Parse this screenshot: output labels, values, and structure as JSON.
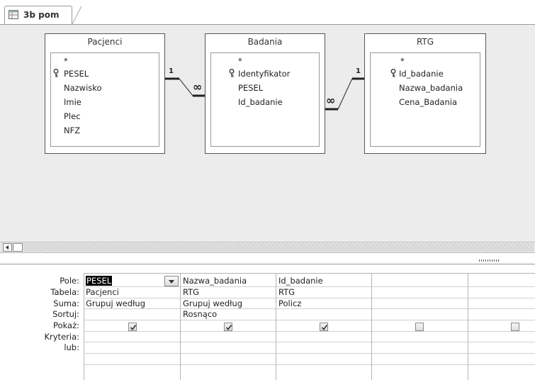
{
  "tab": {
    "label": "3b pom",
    "icon": "query-icon"
  },
  "tables": [
    {
      "title": "Pacjenci",
      "fields": [
        "*",
        "PESEL",
        "Nazwisko",
        "Imie",
        "Plec",
        "NFZ"
      ],
      "key_field": "PESEL"
    },
    {
      "title": "Badania",
      "fields": [
        "*",
        "Identyfikator",
        "PESEL",
        "Id_badanie"
      ],
      "key_field": "Identyfikator"
    },
    {
      "title": "RTG",
      "fields": [
        "*",
        "Id_badanie",
        "Nazwa_badania",
        "Cena_Badania"
      ],
      "key_field": "Id_badanie"
    }
  ],
  "relations": [
    {
      "one": "1",
      "many": "∞"
    },
    {
      "one": "1",
      "many": "∞"
    }
  ],
  "grid": {
    "row_labels": [
      "Pole:",
      "Tabela:",
      "Suma:",
      "Sortuj:",
      "Pokaż:",
      "Kryteria:",
      "lub:"
    ],
    "columns": [
      {
        "pole": "PESEL",
        "tabela": "Pacjenci",
        "suma": "Grupuj według",
        "sortuj": "",
        "pokaz": true
      },
      {
        "pole": "Nazwa_badania",
        "tabela": "RTG",
        "suma": "Grupuj według",
        "sortuj": "Rosnąco",
        "pokaz": true
      },
      {
        "pole": "Id_badanie",
        "tabela": "RTG",
        "suma": "Policz",
        "sortuj": "",
        "pokaz": true
      },
      {
        "pole": "",
        "tabela": "",
        "suma": "",
        "sortuj": "",
        "pokaz": false
      },
      {
        "pole": "",
        "tabela": "",
        "suma": "",
        "sortuj": "",
        "pokaz": false
      }
    ]
  },
  "colors": {
    "design_bg": "#ececec",
    "selection": "#000000"
  }
}
